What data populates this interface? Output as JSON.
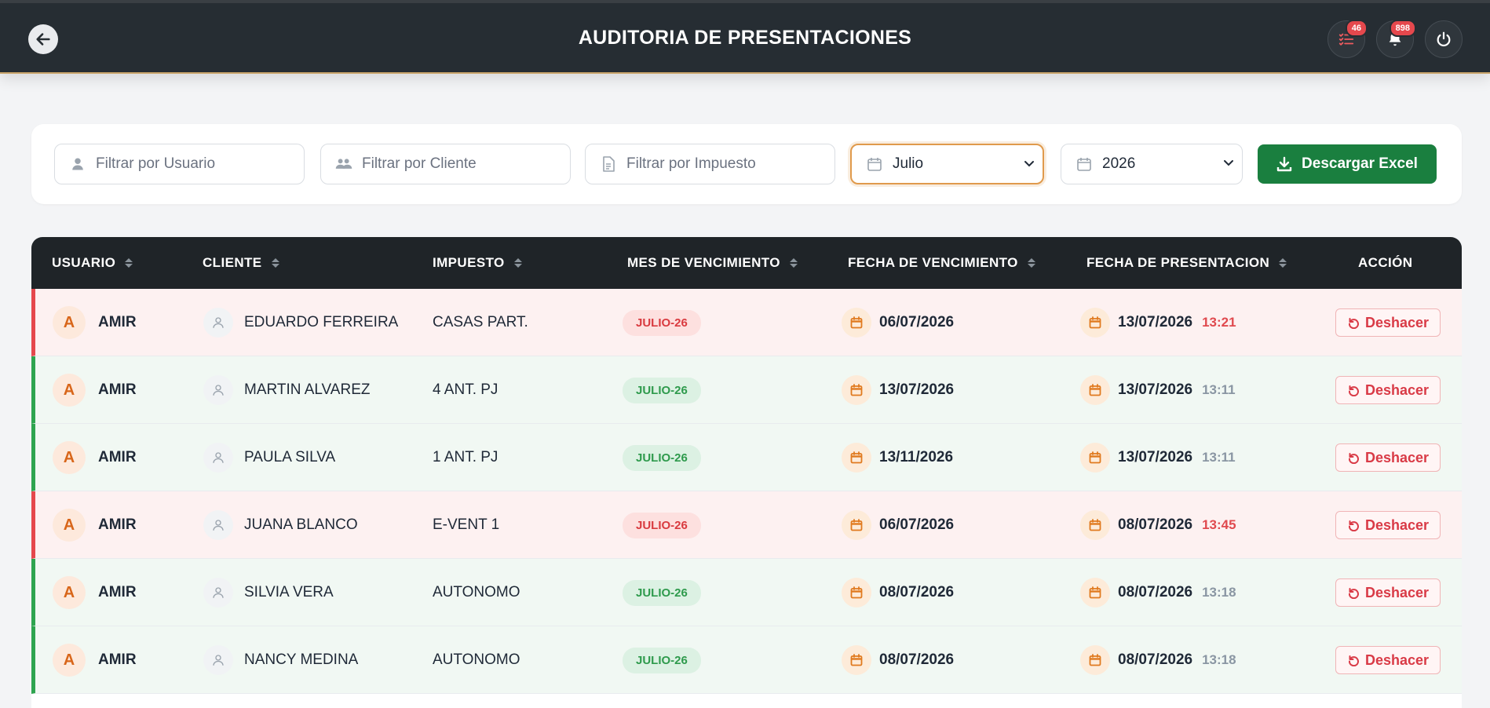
{
  "header": {
    "title": "AUDITORIA DE PRESENTACIONES",
    "tasks_badge": "46",
    "notifications_badge": "898"
  },
  "filters": {
    "user_placeholder": "Filtrar por Usuario",
    "client_placeholder": "Filtrar por Cliente",
    "tax_placeholder": "Filtrar por Impuesto",
    "month_value": "Julio",
    "year_value": "2026",
    "excel_label": "Descargar Excel"
  },
  "table": {
    "columns": [
      "USUARIO",
      "CLIENTE",
      "IMPUESTO",
      "MES DE VENCIMIENTO",
      "FECHA DE VENCIMIENTO",
      "FECHA DE PRESENTACION",
      "ACCIÓN"
    ],
    "rows": [
      {
        "initial": "A",
        "user": "AMIR",
        "client": "EDUARDO FERREIRA",
        "tax": "CASAS PART.",
        "month": "JULIO-26",
        "due": "06/07/2026",
        "presented": "13/07/2026",
        "time": "13:21",
        "status": "late",
        "action": "Deshacer"
      },
      {
        "initial": "A",
        "user": "AMIR",
        "client": "MARTIN ALVAREZ",
        "tax": "4 ANT. PJ",
        "month": "JULIO-26",
        "due": "13/07/2026",
        "presented": "13/07/2026",
        "time": "13:11",
        "status": "ok",
        "action": "Deshacer"
      },
      {
        "initial": "A",
        "user": "AMIR",
        "client": "PAULA SILVA",
        "tax": "1 ANT. PJ",
        "month": "JULIO-26",
        "due": "13/11/2026",
        "presented": "13/07/2026",
        "time": "13:11",
        "status": "ok",
        "action": "Deshacer"
      },
      {
        "initial": "A",
        "user": "AMIR",
        "client": "JUANA BLANCO",
        "tax": "E-VENT 1",
        "month": "JULIO-26",
        "due": "06/07/2026",
        "presented": "08/07/2026",
        "time": "13:45",
        "status": "late",
        "action": "Deshacer"
      },
      {
        "initial": "A",
        "user": "AMIR",
        "client": "SILVIA VERA",
        "tax": "AUTONOMO",
        "month": "JULIO-26",
        "due": "08/07/2026",
        "presented": "08/07/2026",
        "time": "13:18",
        "status": "ok",
        "action": "Deshacer"
      },
      {
        "initial": "A",
        "user": "AMIR",
        "client": "NANCY MEDINA",
        "tax": "AUTONOMO",
        "month": "JULIO-26",
        "due": "08/07/2026",
        "presented": "08/07/2026",
        "time": "13:18",
        "status": "ok",
        "action": "Deshacer"
      }
    ]
  }
}
